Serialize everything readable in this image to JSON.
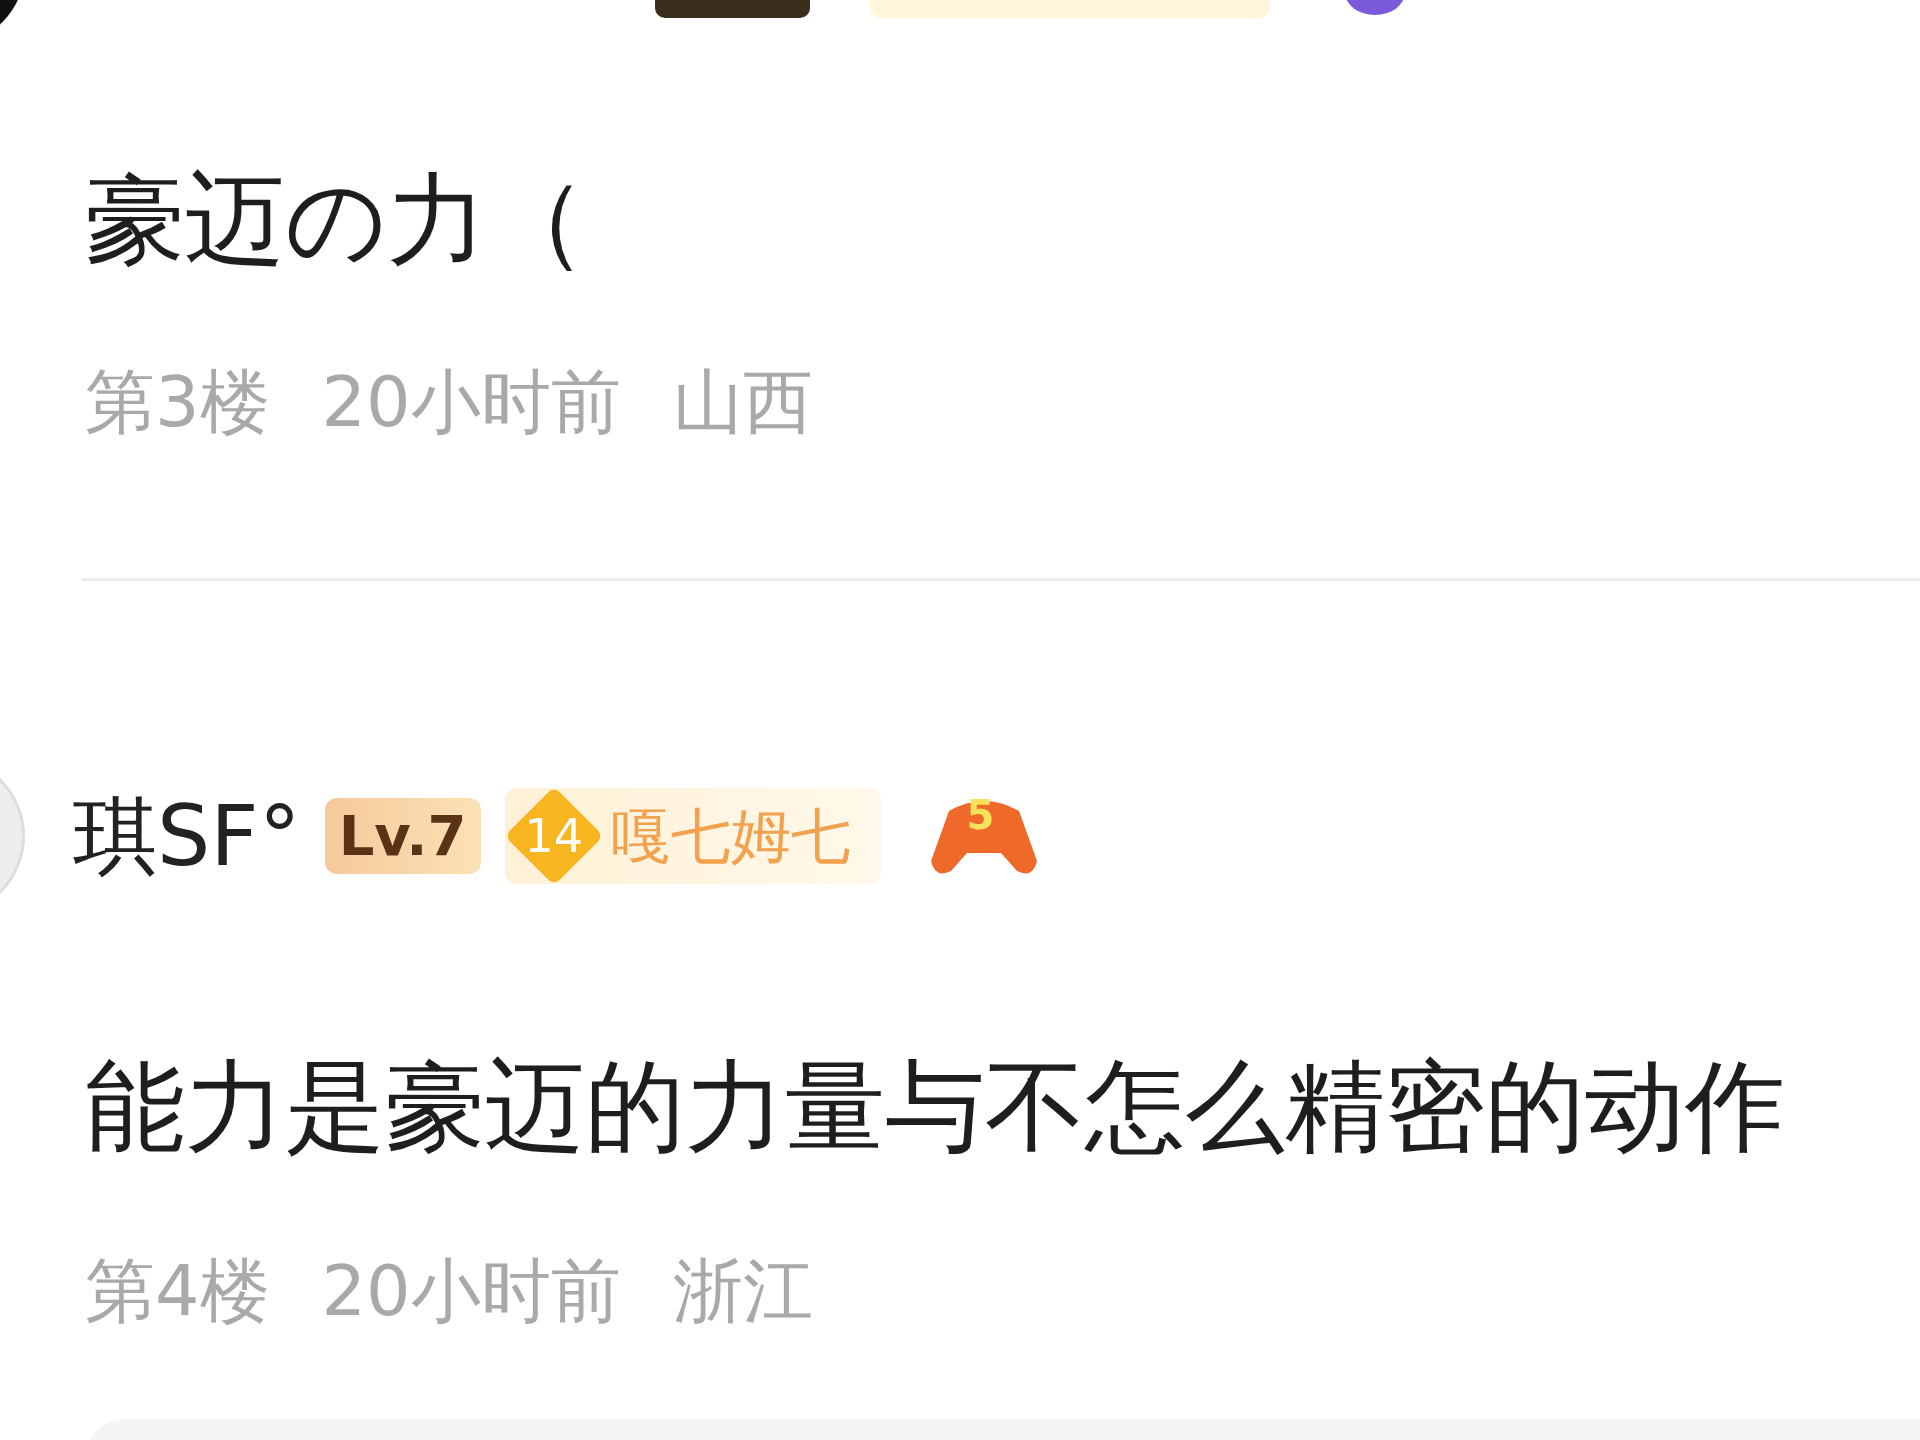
{
  "comments": [
    {
      "content": "豪迈の力（",
      "floor": "第3楼",
      "time": "20小时前",
      "location": "山西"
    },
    {
      "user": {
        "name": "琪SF°",
        "level": "Lv.7",
        "fan_badge_level": "14",
        "fan_badge_name": "嘎七姆七",
        "game_badge": "5"
      },
      "content": "能力是豪迈的力量与不怎么精密的动作",
      "floor": "第4楼",
      "time": "20小时前",
      "location": "浙江"
    }
  ]
}
